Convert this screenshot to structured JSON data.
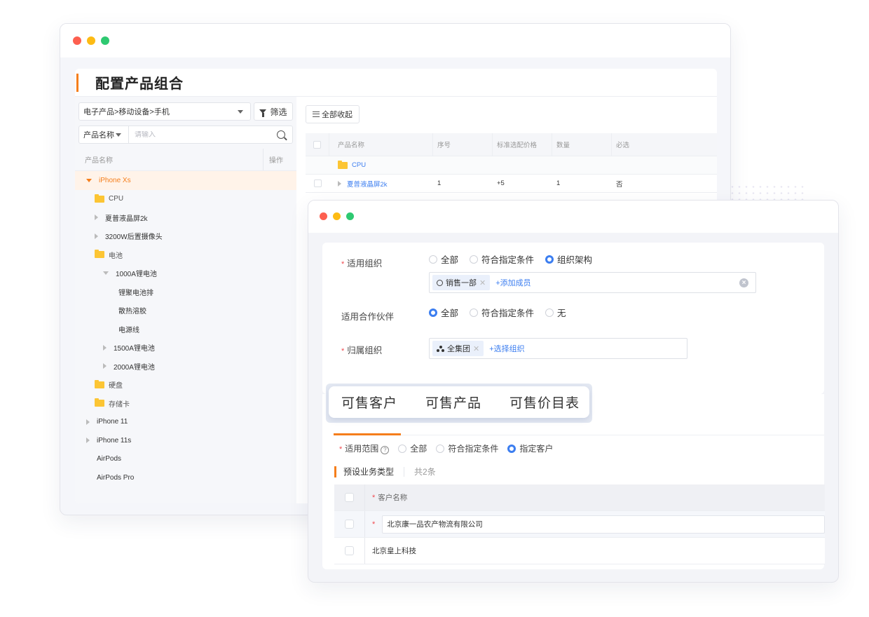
{
  "back_window": {
    "page_title": "配置产品组合",
    "category_select": {
      "value": "电子产品>移动设备>手机"
    },
    "filter_button": {
      "label": "筛选"
    },
    "search": {
      "field": "产品名称",
      "placeholder": "请输入"
    },
    "tree_header": {
      "name": "产品名称",
      "action": "操作"
    },
    "tree": [
      {
        "label": "iPhone Xs",
        "type": "expanded",
        "level": 0,
        "selected": true
      },
      {
        "label": "CPU",
        "type": "folder",
        "level": 1
      },
      {
        "label": "夏普液晶屏2k",
        "type": "collapsed",
        "level": 1
      },
      {
        "label": "3200W后置摄像头",
        "type": "collapsed",
        "level": 1
      },
      {
        "label": "电池",
        "type": "folder",
        "level": 1
      },
      {
        "label": "1000A锂电池",
        "type": "expanded",
        "level": 2
      },
      {
        "label": "锂聚电池排",
        "type": "leaf",
        "level": 3
      },
      {
        "label": "散热溶胶",
        "type": "leaf",
        "level": 3
      },
      {
        "label": "电源线",
        "type": "leaf",
        "level": 3
      },
      {
        "label": "1500A锂电池",
        "type": "collapsed",
        "level": 2
      },
      {
        "label": "2000A锂电池",
        "type": "collapsed",
        "level": 2
      },
      {
        "label": "硬盘",
        "type": "folder",
        "level": 1
      },
      {
        "label": "存储卡",
        "type": "folder",
        "level": 1
      },
      {
        "label": "iPhone 11",
        "type": "collapsed",
        "level": 0
      },
      {
        "label": "iPhone 11s",
        "type": "collapsed",
        "level": 0
      },
      {
        "label": "AirPods",
        "type": "leaf",
        "level": 0
      },
      {
        "label": "AirPods Pro",
        "type": "leaf",
        "level": 0
      }
    ],
    "collapse_all_button": {
      "label": "全部收起"
    },
    "product_table": {
      "columns": [
        "产品名称",
        "序号",
        "标准选配价格",
        "数量",
        "必选"
      ],
      "folder_row": {
        "name": "CPU"
      },
      "rows": [
        {
          "name": "夏普液晶屏2k",
          "seq": "1",
          "price": "+5",
          "qty": "1",
          "required": "否"
        }
      ]
    }
  },
  "front_window": {
    "form": {
      "applicable_org": {
        "label": "适用组织",
        "options": [
          "全部",
          "符合指定条件",
          "组织架构"
        ],
        "selected": 2,
        "tags": [
          "销售一部"
        ],
        "add_label": "+添加成员"
      },
      "applicable_partner": {
        "label": "适用合作伙伴",
        "options": [
          "全部",
          "符合指定条件",
          "无"
        ],
        "selected": 0
      },
      "owner_org": {
        "label": "归属组织",
        "tags": [
          "全集团"
        ],
        "add_label": "+选择组织"
      }
    },
    "tabs": [
      "可售客户",
      "可售产品",
      "可售价目表"
    ],
    "active_tab": 0,
    "scope": {
      "label": "适用范围",
      "options": [
        "全部",
        "符合指定条件",
        "指定客户"
      ],
      "selected": 2
    },
    "section": {
      "title": "预设业务类型",
      "count": "共2条"
    },
    "customer_table": {
      "header": "客户名称",
      "rows": [
        "北京康一品农产物流有限公司",
        "北京皇上科技"
      ]
    }
  },
  "colors": {
    "accent": "#f57e1b",
    "primary": "#3c7ef0",
    "required": "#f0494f"
  }
}
